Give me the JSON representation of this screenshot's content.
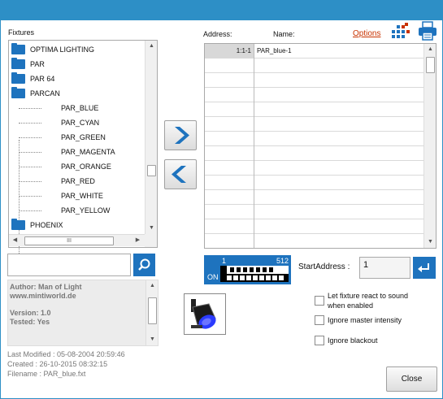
{
  "window": {
    "title": ""
  },
  "fixtures": {
    "label": "Fixtures",
    "tree": [
      {
        "label": "OPTIMA LIGHTING",
        "type": "folder"
      },
      {
        "label": "PAR",
        "type": "folder"
      },
      {
        "label": "PAR 64",
        "type": "folder"
      },
      {
        "label": "PARCAN",
        "type": "folder"
      },
      {
        "label": "PAR_BLUE",
        "type": "item"
      },
      {
        "label": "PAR_CYAN",
        "type": "item"
      },
      {
        "label": "PAR_GREEN",
        "type": "item"
      },
      {
        "label": "PAR_MAGENTA",
        "type": "item"
      },
      {
        "label": "PAR_ORANGE",
        "type": "item"
      },
      {
        "label": "PAR_RED",
        "type": "item"
      },
      {
        "label": "PAR_WHITE",
        "type": "item"
      },
      {
        "label": "PAR_YELLOW",
        "type": "item"
      },
      {
        "label": "PHOENIX",
        "type": "folder"
      }
    ],
    "hscroll_thumb": "III"
  },
  "search": {
    "value": "",
    "placeholder": ""
  },
  "info": {
    "author": "Author: Man of Light",
    "website": "www.mintiworld.de",
    "version": "Version: 1.0",
    "tested": "Tested: Yes"
  },
  "meta": {
    "last_modified": "Last Modified : 05-08-2004 20:59:46",
    "created": "Created : 26-10-2015 08:32:15",
    "filename": "Filename : PAR_blue.fxt"
  },
  "patch": {
    "address_header": "Address:",
    "name_header": "Name:",
    "options_label": "Options",
    "rows": [
      {
        "address": "1:1-1",
        "name": "PAR_blue-1"
      }
    ],
    "empty_row_count": 13
  },
  "dmx": {
    "range_start": "1",
    "range_end": "512",
    "on_label": "ON"
  },
  "start_address": {
    "label": "StartAddress :",
    "value": "1"
  },
  "options": [
    {
      "label": "Let fixture react to sound when enabled",
      "line1": "Let fixture react to sound",
      "line2": "when enabled",
      "checked": false
    },
    {
      "label": "Ignore master intensity",
      "checked": false
    },
    {
      "label": "Ignore blackout",
      "checked": false
    }
  ],
  "buttons": {
    "close": "Close"
  },
  "colors": {
    "accent": "#1e73be",
    "titlebar": "#2d8fc6",
    "link": "#c83200"
  }
}
